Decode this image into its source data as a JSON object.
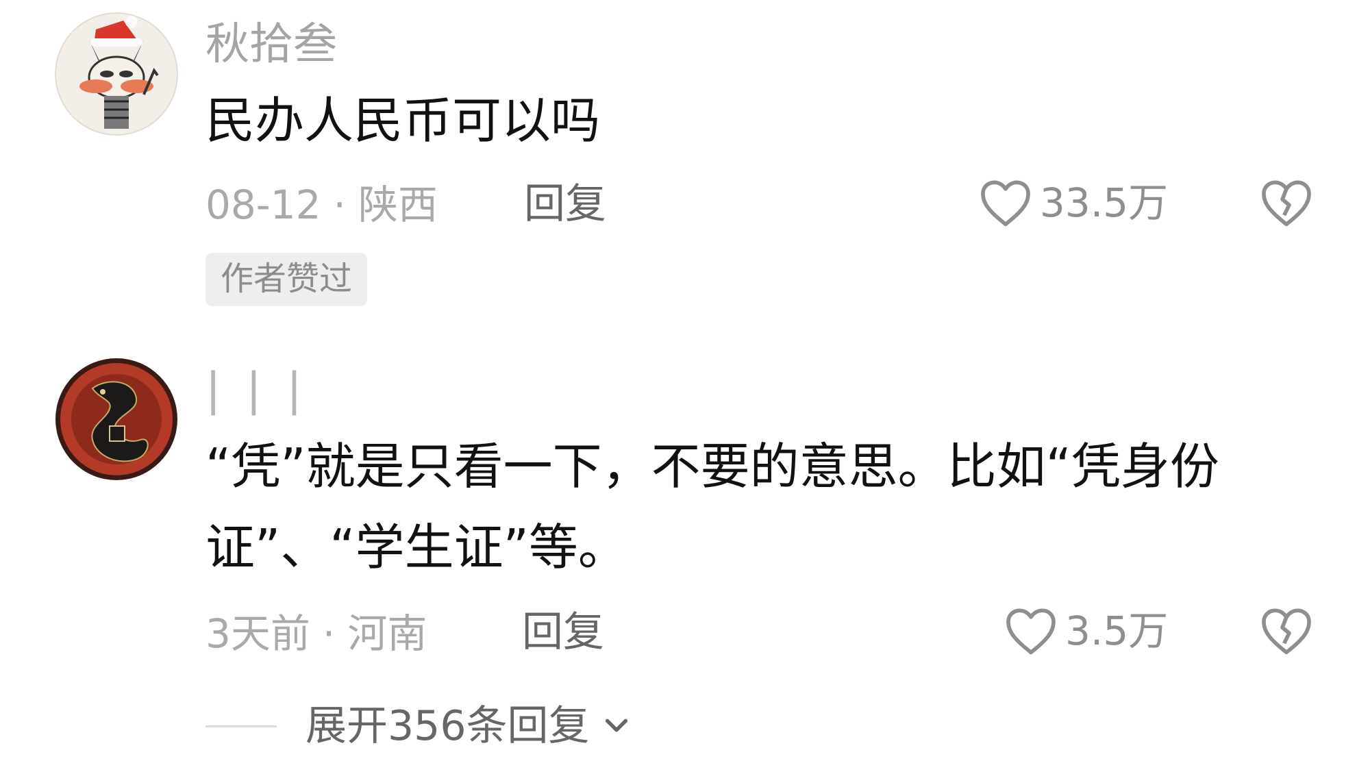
{
  "comments": [
    {
      "username": "秋拾叁",
      "content": "民办人民币可以吗",
      "date": "08-12",
      "separator": "·",
      "location": "陕西",
      "reply_label": "回复",
      "likes": "33.5万",
      "badge": "作者赞过"
    },
    {
      "username": "| | |",
      "content": "“凭”就是只看一下，不要的意思。比如“凭身份证”、“学生证”等。",
      "date": "3天前",
      "separator": "·",
      "location": "河南",
      "reply_label": "回复",
      "likes": "3.5万"
    }
  ],
  "expand_replies_label": "展开356条回复",
  "icons": {
    "like": "heart-outline-icon",
    "dislike": "broken-heart-icon",
    "expand": "chevron-down-icon"
  }
}
